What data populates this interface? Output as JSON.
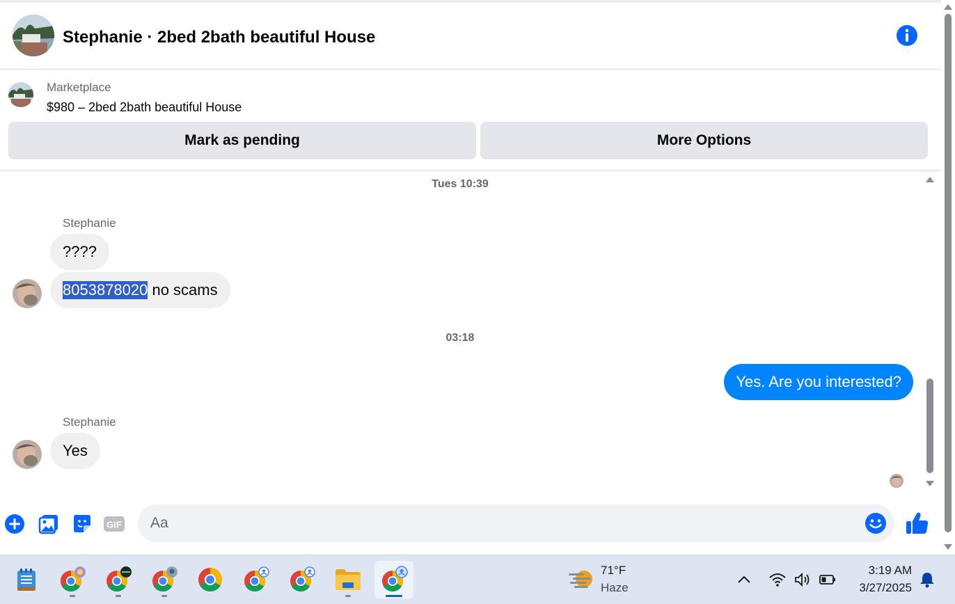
{
  "conversation": {
    "title": "Stephanie · 2bed 2bath beautiful House"
  },
  "listing": {
    "label": "Marketplace",
    "price_title": "$980 – 2bed 2bath beautiful House",
    "pending_button": "Mark as pending",
    "options_button": "More Options"
  },
  "messages": {
    "timestamp_1": "Tues 10:39",
    "sender_1": "Stephanie",
    "msg_1": "????",
    "msg_2_highlight": "8053878020",
    "msg_2_rest": " no scams",
    "timestamp_2": "03:18",
    "msg_3": "Yes. Are you interested?",
    "sender_2": "Stephanie",
    "msg_4": "Yes"
  },
  "composer": {
    "placeholder": "Aa",
    "gif_label": "GIF"
  },
  "taskbar": {
    "weather_temp": "71°F",
    "weather_desc": "Haze",
    "time": "3:19 AM",
    "date": "3/27/2025"
  },
  "colors": {
    "accent": "#0084ff",
    "icon_blue": "#0866ff",
    "bubble_in": "#f0f0f0",
    "button_gray": "#e4e6eb"
  }
}
